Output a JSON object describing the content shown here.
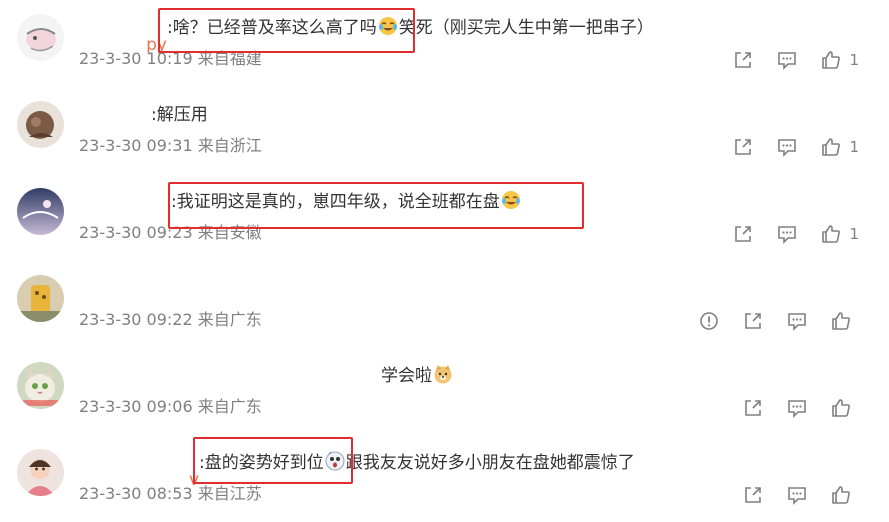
{
  "comments": [
    {
      "username": "py",
      "text": ":啥？已经普及率这么高了吗",
      "text_after": "笑死（刚买完人生中第一把串子）",
      "emoji": "laugh-cry-emoji",
      "time": "23-3-30 10:19",
      "location": "来自福建",
      "likes": "1",
      "actions": [
        "share",
        "comment",
        "like"
      ]
    },
    {
      "username": "",
      "text": ":解压用",
      "text_after": "",
      "time": "23-3-30 09:31",
      "location": "来自浙江",
      "likes": "1",
      "actions": [
        "share",
        "comment",
        "like"
      ]
    },
    {
      "username": "",
      "text": ":我证明这是真的，崽四年级，说全班都在盘",
      "text_after": "",
      "emoji": "laugh-cry-emoji",
      "time": "23-3-30 09:23",
      "location": "来自安徽",
      "likes": "1",
      "actions": [
        "share",
        "comment",
        "like"
      ]
    },
    {
      "username": "",
      "text": "",
      "text_after": "",
      "time": "23-3-30 09:22",
      "location": "来自广东",
      "likes": "",
      "actions": [
        "report",
        "share",
        "comment",
        "like"
      ]
    },
    {
      "username": "",
      "text": "学会啦",
      "text_after": "",
      "emoji": "doge-emoji",
      "time": "23-3-30 09:06",
      "location": "来自广东",
      "likes": "",
      "actions": [
        "share",
        "comment",
        "like"
      ]
    },
    {
      "username": "v",
      "text": ":盘的姿势好到位",
      "text_after": "跟我友友说好多小朋友在盘她都震惊了",
      "emoji": "shocked-emoji",
      "time": "23-3-30 08:53",
      "location": "来自江苏",
      "likes": "",
      "actions": [
        "share",
        "comment",
        "like"
      ]
    }
  ],
  "colors": {
    "username": "#eb7350",
    "text": "#333333",
    "meta": "#808080",
    "highlight_box": "#e02d2d"
  }
}
